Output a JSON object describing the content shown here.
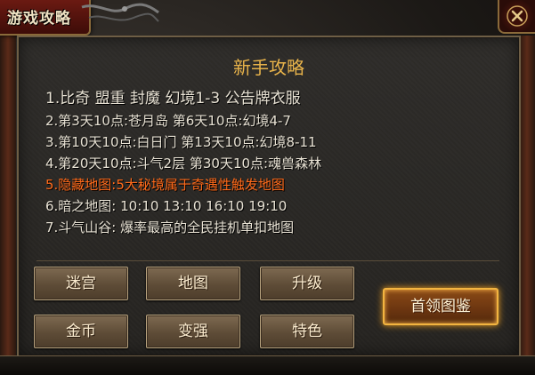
{
  "window": {
    "title": "游戏攻略"
  },
  "panel": {
    "heading": "新手攻略",
    "lines": [
      "1.比奇 盟重 封魔 幻境1-3 公告牌衣服",
      "2.第3天10点:苍月岛 第6天10点:幻境4-7",
      "3.第10天10点:白日门 第13天10点:幻境8-11",
      "4.第20天10点:斗气2层 第30天10点:魂兽森林",
      "5.隐藏地图:5大秘境属于奇遇性触发地图",
      "6.暗之地图:  10:10 13:10 16:10 19:10",
      "7.斗气山谷:  爆率最高的全民挂机单扣地图"
    ],
    "highlight_color": "#ff6a1a"
  },
  "buttons": {
    "maze": "迷宫",
    "map": "地图",
    "upgrade": "升级",
    "gold": "金币",
    "strengthen": "变强",
    "features": "特色",
    "boss_guide": "首领图鉴"
  },
  "icons": {
    "close": "close-icon",
    "ornament": "dragon-ornament-icon"
  }
}
